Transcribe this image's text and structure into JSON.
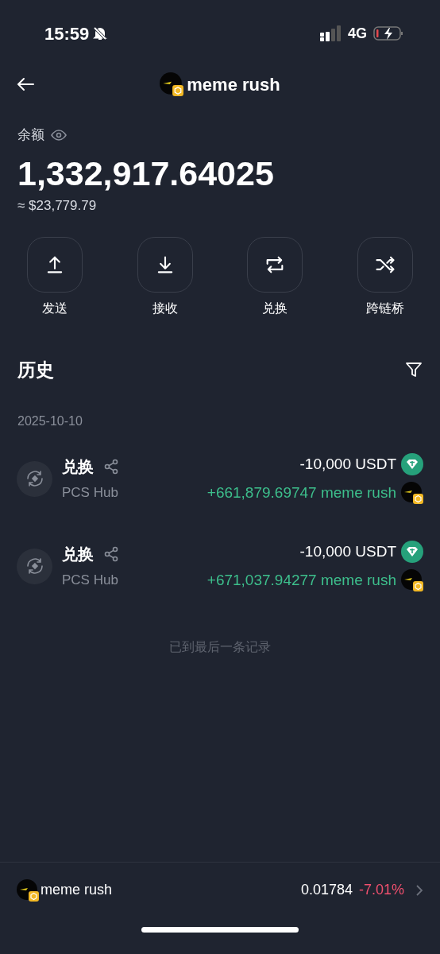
{
  "status_bar": {
    "time": "15:59",
    "network": "4G"
  },
  "header": {
    "title": "meme rush"
  },
  "balance": {
    "label": "余额",
    "amount": "1,332,917.64025",
    "fiat": "≈ $23,779.79"
  },
  "actions": [
    {
      "kind": "send",
      "label": "发送"
    },
    {
      "kind": "receive",
      "label": "接收"
    },
    {
      "kind": "swap",
      "label": "兑换"
    },
    {
      "kind": "bridge",
      "label": "跨链桥"
    }
  ],
  "history": {
    "title": "历史",
    "date": "2025-10-10",
    "rows": [
      {
        "title": "兑换",
        "source": "PCS Hub",
        "amounts": [
          {
            "kind": "usdt",
            "credit": false,
            "text": "-10,000 USDT"
          },
          {
            "kind": "meme",
            "credit": true,
            "text": "+661,879.69747 meme rush"
          }
        ]
      },
      {
        "title": "兑换",
        "source": "PCS Hub",
        "amounts": [
          {
            "kind": "usdt",
            "credit": false,
            "text": "-10,000 USDT"
          },
          {
            "kind": "meme",
            "credit": true,
            "text": "+671,037.94277 meme rush"
          }
        ]
      }
    ],
    "end_note": "已到最后一条记录"
  },
  "footer": {
    "name": "meme rush",
    "price": "0.01784",
    "change": "-7.01%",
    "kind": "down"
  }
}
